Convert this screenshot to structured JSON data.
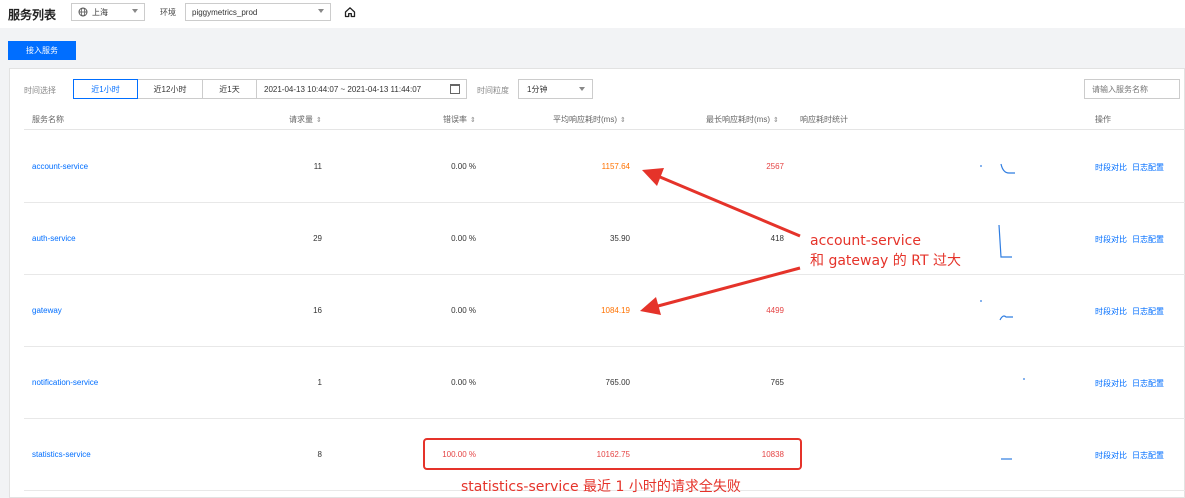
{
  "header": {
    "title": "服务列表",
    "region": "上海",
    "env_label": "环境",
    "env": "piggymetrics_prod"
  },
  "toolbar": {
    "add_service": "接入服务"
  },
  "filters": {
    "time_label": "时间选择",
    "tabs": [
      "近1小时",
      "近12小时",
      "近1天"
    ],
    "active_tab": "近1小时",
    "range": "2021-04-13 10:44:07 ~ 2021-04-13 11:44:07",
    "granularity_label": "时间粒度",
    "granularity": "1分钟",
    "search_placeholder": "请输入服务名称"
  },
  "table": {
    "headers": {
      "name": "服务名称",
      "requests": "请求量",
      "error_rate": "错误率",
      "avg_rt": "平均响应耗时(ms)",
      "max_rt": "最长响应耗时(ms)",
      "rt_stats": "响应耗时统计",
      "ops": "操作"
    },
    "sort_glyph": "⇕",
    "ops_labels": [
      "时段对比",
      "日志配置"
    ],
    "rows": [
      {
        "name": "account-service",
        "requests": "11",
        "error_rate": "0.00 %",
        "avg_rt": "1157.64",
        "max_rt": "2567"
      },
      {
        "name": "auth-service",
        "requests": "29",
        "error_rate": "0.00 %",
        "avg_rt": "35.90",
        "max_rt": "418"
      },
      {
        "name": "gateway",
        "requests": "16",
        "error_rate": "0.00 %",
        "avg_rt": "1084.19",
        "max_rt": "4499"
      },
      {
        "name": "notification-service",
        "requests": "1",
        "error_rate": "0.00 %",
        "avg_rt": "765.00",
        "max_rt": "765"
      },
      {
        "name": "statistics-service",
        "requests": "8",
        "error_rate": "100.00 %",
        "avg_rt": "10162.75",
        "max_rt": "10838"
      }
    ]
  },
  "annotations": {
    "rt_line1": "account-service",
    "rt_line2": "和 gateway 的 RT 过大",
    "stats_note": "statistics-service 最近 1 小时的请求全失败"
  },
  "colors": {
    "accent": "#006eff",
    "warn": "#ff7200",
    "danger": "#e54545",
    "annotation": "#e5332a"
  }
}
